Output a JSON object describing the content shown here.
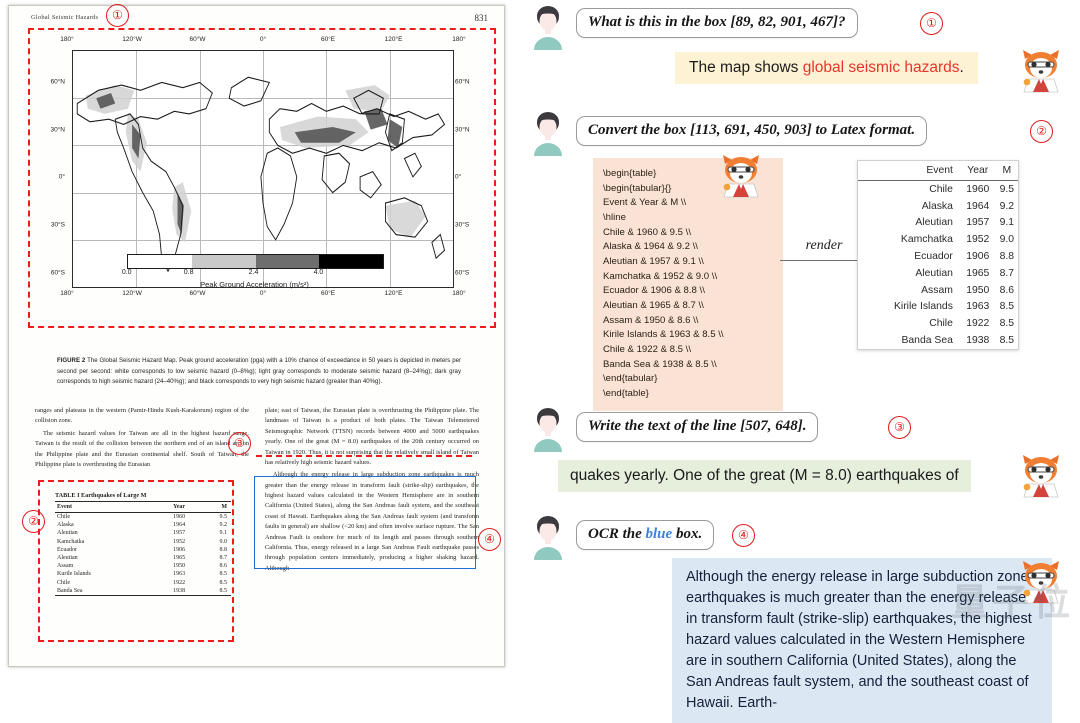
{
  "document": {
    "header_title": "Global Seismic Hazards",
    "page_number": "831",
    "map": {
      "lon_labels": [
        "180°",
        "120°W",
        "60°W",
        "0°",
        "60°E",
        "120°E",
        "180°"
      ],
      "lat_labels": [
        "60°N",
        "30°N",
        "0°",
        "30°S",
        "60°S"
      ],
      "colorbar_ticks": [
        "0.0",
        "0.8",
        "2.4",
        "4.0"
      ],
      "colorbar_label": "Peak Ground Acceleration (m/s²)",
      "colorbar_colors": [
        "#ffffff",
        "#c9c9c9",
        "#6e6e6e",
        "#000000"
      ]
    },
    "figure_caption_label": "FIGURE 2",
    "figure_caption": "The Global Seismic Hazard Map. Peak ground acceleration (pga) with a 10% chance of exceedance in 50 years is depicted in meters per second per second: white corresponds to low seismic hazard (0–8%g); light gray corresponds to moderate seismic hazard (8–24%g); dark gray corresponds to high seismic hazard (24–40%g); and black corresponds to very high seismic hazard (greater than 40%g).",
    "left_column": [
      "ranges and plateaus in the western (Pamir-Hindu Kush-Karakorum) region of the collision zone.",
      "The seismic hazard values for Taiwan are all in the highest hazard range. Taiwan is the result of the collision between the northern end of an island arc on the Philippine plate and the Eurasian continental shelf. South of Taiwan, the Philippine plate is overthrusting the Eurasian"
    ],
    "right_column": [
      "plate; east of Taiwan, the Eurasian plate is overthrusting the Philippine plate. The landmass of Taiwan is a product of both plates. The Taiwan Telemetered Seismographic Network (TTSN) records between 4000 and 5000 earthquakes yearly. One of the great (M = 8.0) earthquakes of the 20th century occurred on Taiwan in 1920. Thus, it is not surprising that the relatively small island of Taiwan has relatively high seismic hazard values.",
      "Although the energy release in large subduction zone earthquakes is much greater than the energy release in transform fault (strike-slip) earthquakes, the highest hazard values calculated in the Western Hemisphere are in southern California (United States), along the San Andreas fault system, and the southeast coast of Hawaii. Earthquakes along the San Andreas fault system (and transform faults in general) are shallow (<20 km) and often involve surface rupture. The San Andreas Fault is onshore for much of its length and passes through southern California. Thus, energy released in a large San Andreas Fault earthquake passes through population centers immediately, producing a higher shaking hazard. Although"
    ],
    "table_title": "TABLE I   Earthquakes of Large M",
    "table_headers": [
      "Event",
      "Year",
      "M"
    ],
    "table_rows": [
      [
        "Chile",
        "1960",
        "9.5"
      ],
      [
        "Alaska",
        "1964",
        "9.2"
      ],
      [
        "Aleutian",
        "1957",
        "9.1"
      ],
      [
        "Kamchatka",
        "1952",
        "9.0"
      ],
      [
        "Ecuador",
        "1906",
        "8.8"
      ],
      [
        "Aleutian",
        "1965",
        "8.7"
      ],
      [
        "Assam",
        "1950",
        "8.6"
      ],
      [
        "Kurile Islands",
        "1963",
        "8.5"
      ],
      [
        "Chile",
        "1922",
        "8.5"
      ],
      [
        "Banda Sea",
        "1938",
        "8.5"
      ]
    ],
    "markers": [
      "①",
      "②",
      "③",
      "④"
    ]
  },
  "chat": {
    "marker1": "①",
    "marker2": "②",
    "marker3": "③",
    "marker4": "④",
    "q1": "What is this in the box [89, 82, 901, 467]?",
    "a1_prefix": "The map shows ",
    "a1_highlight": "global seismic hazards",
    "a1_suffix": ".",
    "q2": "Convert the box [113, 691, 450, 903] to Latex format.",
    "a2_code": "\\begin{table}\n\\begin{tabular}{}\nEvent & Year & M \\\\\n\\hline\nChile & 1960 & 9.5 \\\\\nAlaska & 1964 & 9.2 \\\\\nAleutian & 1957 & 9.1 \\\\\nKamchatka & 1952 & 9.0 \\\\\nEcuador & 1906 & 8.8 \\\\\nAleutian & 1965 & 8.7 \\\\\nAssam & 1950 & 8.6 \\\\\nKirile Islands & 1963 & 8.5 \\\\\nChile & 1922 & 8.5 \\\\\nBanda Sea & 1938 & 8.5 \\\\\n\\end{tabular}\n\\end{table}",
    "render_label": "render",
    "rendered_table": {
      "headers": [
        "Event",
        "Year",
        "M"
      ],
      "rows": [
        [
          "Chile",
          "1960",
          "9.5"
        ],
        [
          "Alaska",
          "1964",
          "9.2"
        ],
        [
          "Aleutian",
          "1957",
          "9.1"
        ],
        [
          "Kamchatka",
          "1952",
          "9.0"
        ],
        [
          "Ecuador",
          "1906",
          "8.8"
        ],
        [
          "Aleutian",
          "1965",
          "8.7"
        ],
        [
          "Assam",
          "1950",
          "8.6"
        ],
        [
          "Kirile Islands",
          "1963",
          "8.5"
        ],
        [
          "Chile",
          "1922",
          "8.5"
        ],
        [
          "Banda Sea",
          "1938",
          "8.5"
        ]
      ]
    },
    "q3": "Write the text of the line [507, 648].",
    "a3": "quakes yearly. One of the great (M = 8.0) earthquakes of",
    "q4_prefix": "OCR the ",
    "q4_highlight": "blue",
    "q4_suffix": " box.",
    "a4": "Although the energy release in large subduction zone earthquakes is much greater than the energy release in transform fault (strike-slip) earthquakes, the highest hazard values calculated in the Western Hemisphere are in southern California (United States), along the San Andreas fault system, and the southeast coast of Hawaii. Earth-",
    "watermark": "量子位"
  },
  "colors": {
    "annotation_red": "#ef1c1c",
    "annotation_blue": "#1f6fd0",
    "answer_yellow": "#fdf2d3",
    "answer_green": "#e6efdc",
    "answer_blue": "#dbe7f3",
    "code_peach": "#fae3d4",
    "highlight_red": "#e8342a"
  }
}
